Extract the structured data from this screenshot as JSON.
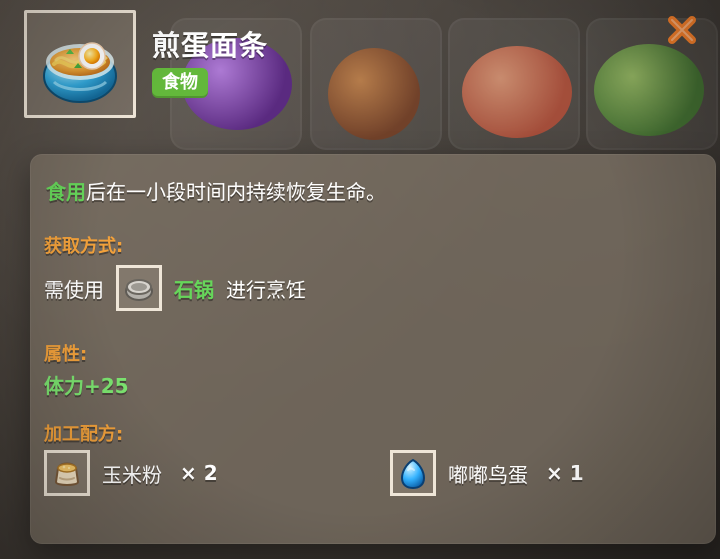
{
  "item": {
    "title": "煎蛋面条",
    "category_tag": "食物",
    "icon": "noodle-bowl-icon"
  },
  "ui": {
    "close_icon": "close-icon",
    "colors": {
      "accent_green": "#66d65a",
      "accent_orange": "#f2a13b",
      "tag_green": "#63b83b",
      "close_orange": "#f07d2a"
    }
  },
  "description": {
    "highlight": "食用",
    "text": "后在一小段时间内持续恢复生命。"
  },
  "sections": {
    "acquire_label": "获取方式:",
    "attributes_label": "属性:",
    "recipe_label": "加工配方:"
  },
  "acquire": {
    "prefix": "需使用",
    "tool_name": "石锅",
    "suffix": "进行烹饪",
    "tool_icon": "stone-pot-icon"
  },
  "attributes": {
    "value": "体力+25"
  },
  "recipe": {
    "items": [
      {
        "name": "玉米粉",
        "qty": "× 2",
        "icon": "cornmeal-sack-icon"
      },
      {
        "name": "嘟嘟鸟蛋",
        "qty": "× 1",
        "icon": "blue-egg-icon"
      }
    ]
  }
}
